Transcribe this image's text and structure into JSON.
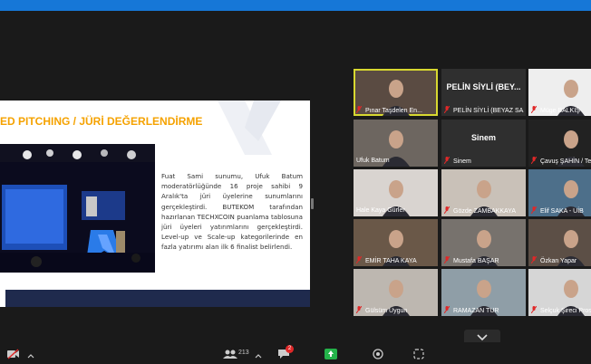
{
  "slide": {
    "title": "ED PITCHING / JÜRİ DEĞERLENDİRME",
    "body": "Fuat Sami sunumu, Ufuk Batum moderatörlüğünde 16 proje sahibi 9 Aralık'ta jüri üyelerine sunumlarını gerçekleştirdi. BUTEKOM tarafından hazırlanan TECHXCOIN puanlama tablosuna jüri üyeleri yatırımlarını gerçekleştirdi. Level-up ve Scale-up kategorilerinde en fazla yatırımı alan ilk 6 finalist belirlendi."
  },
  "gallery": {
    "tiles": [
      {
        "name": "Pınar Taşdelen En...",
        "center": "",
        "active": true,
        "bg": "#5a4b42",
        "mic": "muted"
      },
      {
        "name": "PELİN SİYLİ (BEYAZ SA...",
        "center": "PELİN SİYLİ (BEY...",
        "active": false,
        "bg": "#2f2f2f",
        "mic": "muted"
      },
      {
        "name": "Müge BALKIŞ",
        "center": "",
        "active": false,
        "bg": "#eeeeee",
        "mic": "muted"
      },
      {
        "name": "Ufuk Batum",
        "center": "",
        "active": false,
        "bg": "#6d6660",
        "mic": "none"
      },
      {
        "name": "Sinem",
        "center": "Sinem",
        "active": false,
        "bg": "#2f2f2f",
        "mic": "muted"
      },
      {
        "name": "Çavuş ŞAHİN / Te",
        "center": "",
        "active": false,
        "bg": "#222222",
        "mic": "muted"
      },
      {
        "name": "Hale Kaya Gürler",
        "center": "",
        "active": false,
        "bg": "#d9d4d0",
        "mic": "none"
      },
      {
        "name": "Gözde ZAMBAKKAYA",
        "center": "",
        "active": false,
        "bg": "#c9c1b8",
        "mic": "muted"
      },
      {
        "name": "Elif SAKA - UİB",
        "center": "",
        "active": false,
        "bg": "#4d6f8a",
        "mic": "muted"
      },
      {
        "name": "EMİR TAHA KAYA",
        "center": "",
        "active": false,
        "bg": "#6a5848",
        "mic": "muted"
      },
      {
        "name": "Mustafa BAŞAR",
        "center": "",
        "active": false,
        "bg": "#77726d",
        "mic": "muted"
      },
      {
        "name": "Özkan Yapar",
        "center": "",
        "active": false,
        "bg": "#5c4f46",
        "mic": "muted"
      },
      {
        "name": "Gülsüm Uygun",
        "center": "",
        "active": false,
        "bg": "#bdb7b0",
        "mic": "muted"
      },
      {
        "name": "RAMAZAN TUR",
        "center": "",
        "active": false,
        "bg": "#8f9ea7",
        "mic": "muted"
      },
      {
        "name": "Selçuk Şireci Pros",
        "center": "",
        "active": false,
        "bg": "#d6d6d6",
        "mic": "muted"
      }
    ]
  },
  "toolbar": {
    "participants_count": "213",
    "chat_badge": "2"
  },
  "colors": {
    "topbar": "#1677d7",
    "accent_title": "#f5a200",
    "muted_mic": "#e02828",
    "share_green": "#24b34a",
    "active_speaker": "#d8d830"
  }
}
